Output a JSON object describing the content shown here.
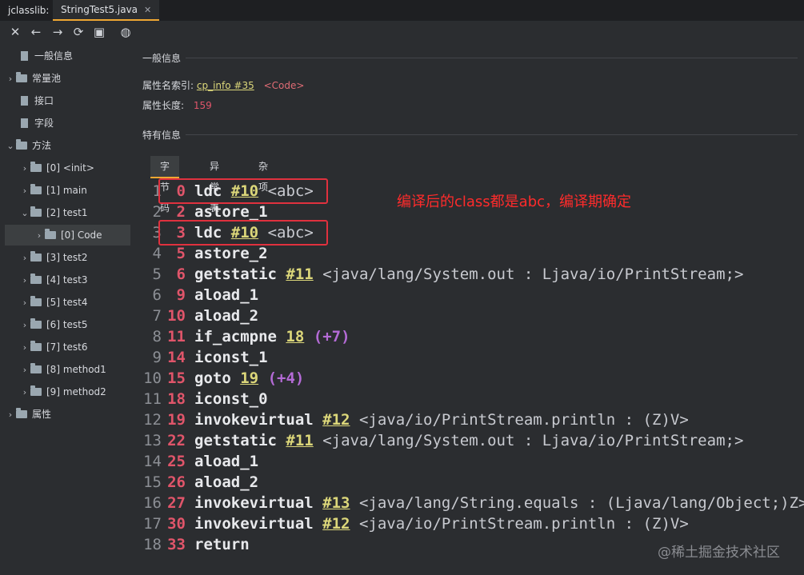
{
  "tabs": {
    "app": "jclasslib:",
    "file": "StringTest5.java",
    "close": "✕"
  },
  "toolbar": {
    "close": "✕",
    "back": "←",
    "forward": "→",
    "refresh": "⟳",
    "save": "▣",
    "web": "◍"
  },
  "tree": {
    "items": [
      {
        "label": "一般信息",
        "arrow": "",
        "icon": "file"
      },
      {
        "label": "常量池",
        "arrow": "›",
        "icon": "folder"
      },
      {
        "label": "接口",
        "arrow": "",
        "icon": "file"
      },
      {
        "label": "字段",
        "arrow": "",
        "icon": "file"
      },
      {
        "label": "方法",
        "arrow": "⌄",
        "icon": "folder"
      },
      {
        "label": "[0] <init>",
        "arrow": "›",
        "icon": "folder"
      },
      {
        "label": "[1] main",
        "arrow": "›",
        "icon": "folder"
      },
      {
        "label": "[2] test1",
        "arrow": "⌄",
        "icon": "folder"
      },
      {
        "label": "[0] Code",
        "arrow": "›",
        "icon": "folder"
      },
      {
        "label": "[3] test2",
        "arrow": "›",
        "icon": "folder"
      },
      {
        "label": "[4] test3",
        "arrow": "›",
        "icon": "folder"
      },
      {
        "label": "[5] test4",
        "arrow": "›",
        "icon": "folder"
      },
      {
        "label": "[6] test5",
        "arrow": "›",
        "icon": "folder"
      },
      {
        "label": "[7] test6",
        "arrow": "›",
        "icon": "folder"
      },
      {
        "label": "[8] method1",
        "arrow": "›",
        "icon": "folder"
      },
      {
        "label": "[9] method2",
        "arrow": "›",
        "icon": "folder"
      },
      {
        "label": "属性",
        "arrow": "›",
        "icon": "folder"
      }
    ]
  },
  "general": {
    "title": "一般信息",
    "name_index_label": "属性名索引:",
    "name_index_link": "cp_info #35",
    "name_index_tag": "<Code>",
    "length_label": "属性长度:",
    "length_value": "159"
  },
  "specific": {
    "title": "特有信息",
    "tabs": [
      "字节码",
      "异常表",
      "杂项"
    ]
  },
  "code": [
    {
      "ln": "1",
      "off": "0",
      "op": "ldc",
      "ref": "#10",
      "jump": "",
      "cmt": "<abc>"
    },
    {
      "ln": "2",
      "off": "2",
      "op": "astore_1",
      "ref": "",
      "jump": "",
      "cmt": ""
    },
    {
      "ln": "3",
      "off": "3",
      "op": "ldc",
      "ref": "#10",
      "jump": "",
      "cmt": "<abc>"
    },
    {
      "ln": "4",
      "off": "5",
      "op": "astore_2",
      "ref": "",
      "jump": "",
      "cmt": ""
    },
    {
      "ln": "5",
      "off": "6",
      "op": "getstatic",
      "ref": "#11",
      "jump": "",
      "cmt": "<java/lang/System.out : Ljava/io/PrintStream;>"
    },
    {
      "ln": "6",
      "off": "9",
      "op": "aload_1",
      "ref": "",
      "jump": "",
      "cmt": ""
    },
    {
      "ln": "7",
      "off": "10",
      "op": "aload_2",
      "ref": "",
      "jump": "",
      "cmt": ""
    },
    {
      "ln": "8",
      "off": "11",
      "op": "if_acmpne",
      "ref": "18",
      "jump": "(+7)",
      "cmt": ""
    },
    {
      "ln": "9",
      "off": "14",
      "op": "iconst_1",
      "ref": "",
      "jump": "",
      "cmt": ""
    },
    {
      "ln": "10",
      "off": "15",
      "op": "goto",
      "ref": "19",
      "jump": "(+4)",
      "cmt": ""
    },
    {
      "ln": "11",
      "off": "18",
      "op": "iconst_0",
      "ref": "",
      "jump": "",
      "cmt": ""
    },
    {
      "ln": "12",
      "off": "19",
      "op": "invokevirtual",
      "ref": "#12",
      "jump": "",
      "cmt": "<java/io/PrintStream.println : (Z)V>"
    },
    {
      "ln": "13",
      "off": "22",
      "op": "getstatic",
      "ref": "#11",
      "jump": "",
      "cmt": "<java/lang/System.out : Ljava/io/PrintStream;>"
    },
    {
      "ln": "14",
      "off": "25",
      "op": "aload_1",
      "ref": "",
      "jump": "",
      "cmt": ""
    },
    {
      "ln": "15",
      "off": "26",
      "op": "aload_2",
      "ref": "",
      "jump": "",
      "cmt": ""
    },
    {
      "ln": "16",
      "off": "27",
      "op": "invokevirtual",
      "ref": "#13",
      "jump": "",
      "cmt": "<java/lang/String.equals : (Ljava/lang/Object;)Z>"
    },
    {
      "ln": "17",
      "off": "30",
      "op": "invokevirtual",
      "ref": "#12",
      "jump": "",
      "cmt": "<java/io/PrintStream.println : (Z)V>"
    },
    {
      "ln": "18",
      "off": "33",
      "op": "return",
      "ref": "",
      "jump": "",
      "cmt": ""
    }
  ],
  "annotation": "编译后的class都是abc，编译期确定",
  "watermark": "@稀土掘金技术社区",
  "colors": {
    "accent": "#f0a732",
    "offset": "#e0556a",
    "ref": "#dcd77a",
    "jump": "#b46bd6",
    "highlight": "#e0313e"
  }
}
